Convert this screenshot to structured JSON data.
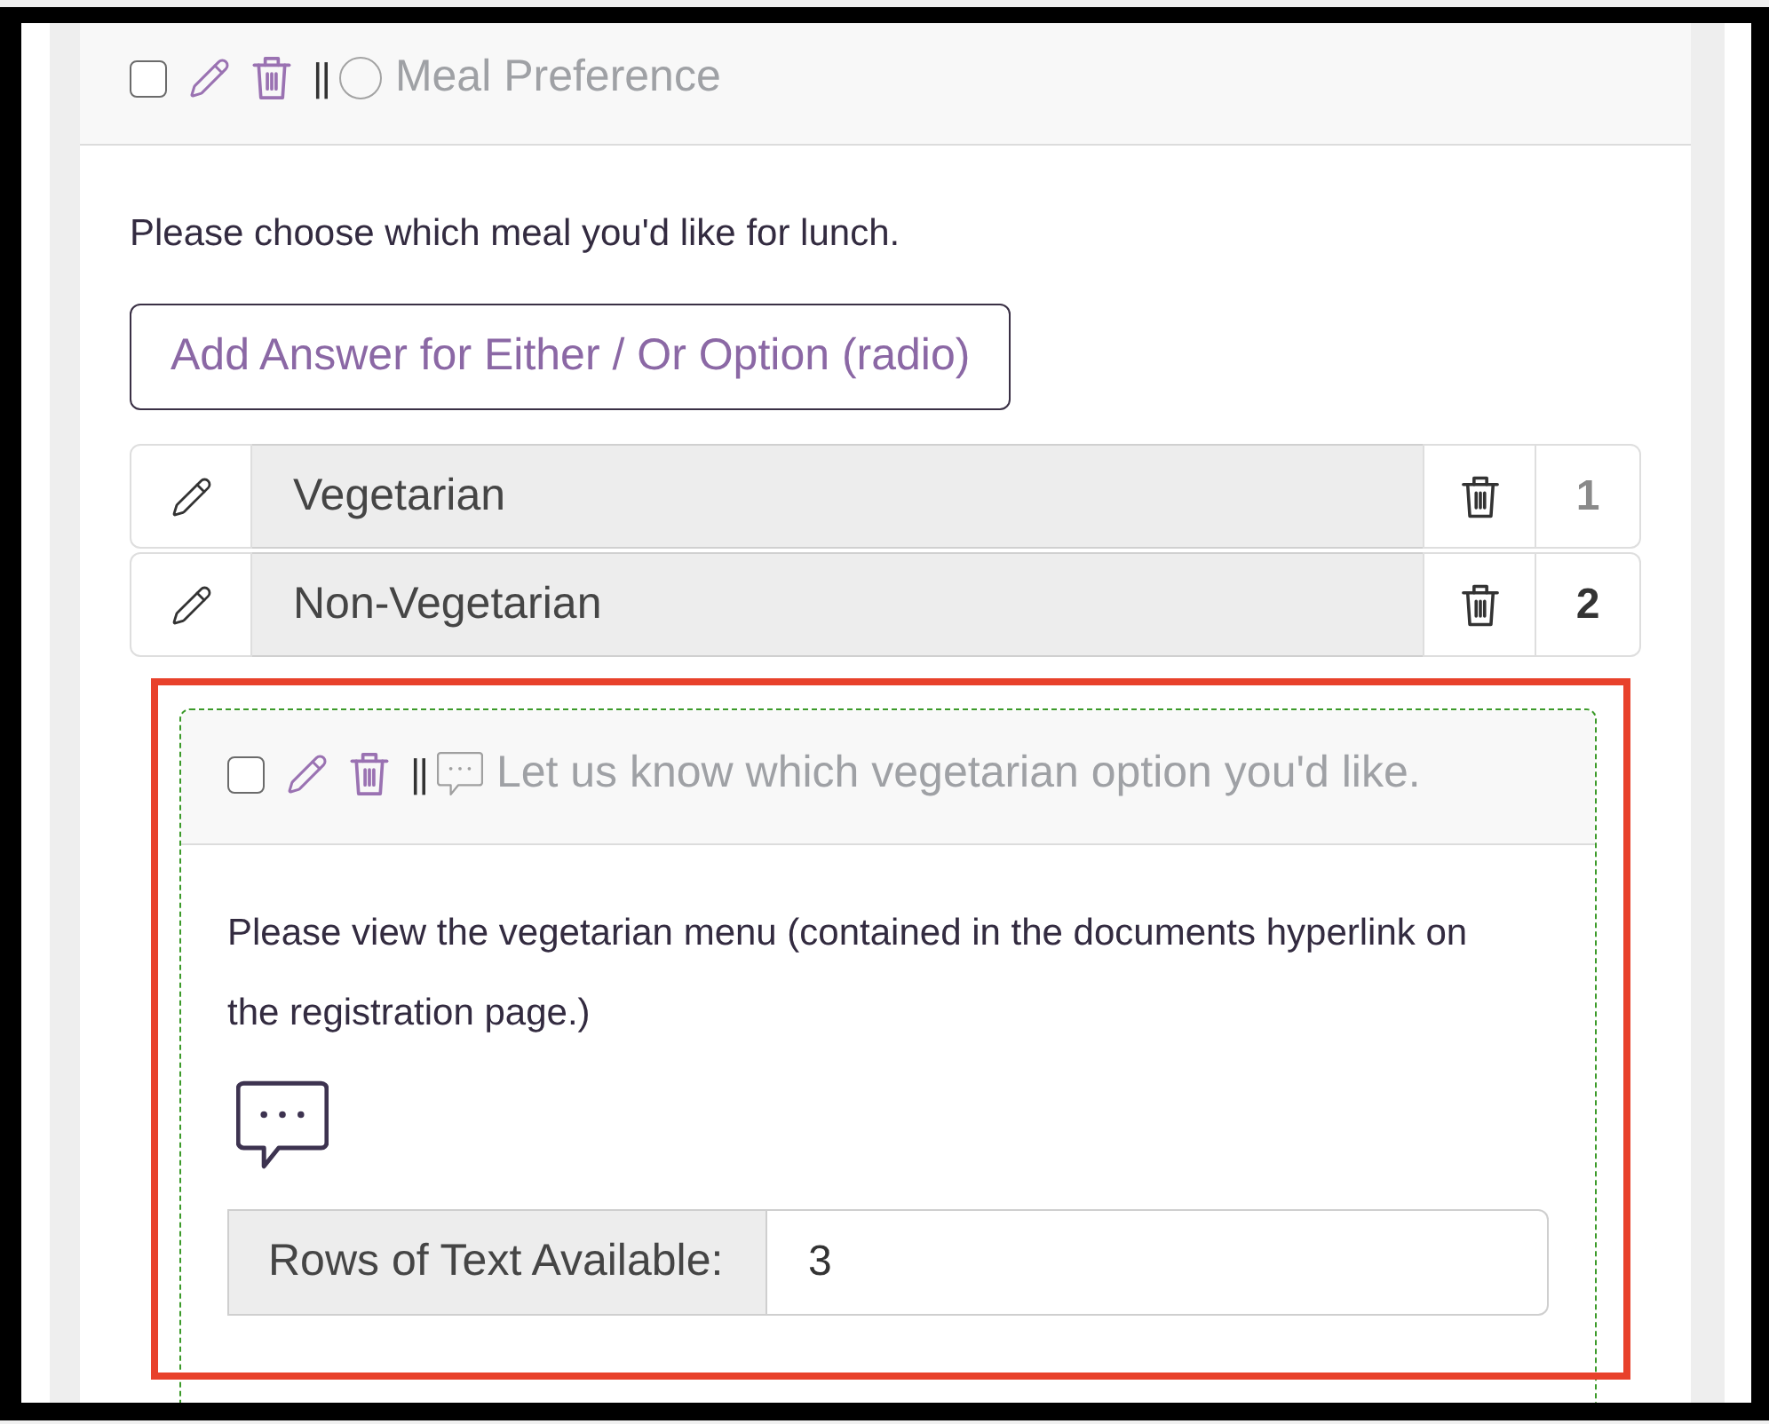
{
  "question": {
    "kind": "radio",
    "checked": false,
    "separator": "||",
    "title": "Meal Preference",
    "description": "Please choose which meal you'd like for lunch.",
    "add_button": "Add Answer for Either / Or Option (radio)",
    "answers": [
      {
        "label": "Vegetarian",
        "number": "1",
        "active": false
      },
      {
        "label": "Non-Vegetarian",
        "number": "2",
        "active": true
      }
    ],
    "follow_up": {
      "kind": "comment",
      "checked": false,
      "highlighted": true,
      "separator": "||",
      "title": "Let us know which vegetarian option you'd like.",
      "description": "Please view the vegetarian menu (contained in the documents hyperlink on the registration page.)",
      "rows_field": {
        "label": "Rows of Text Available:",
        "value": "3"
      }
    }
  }
}
